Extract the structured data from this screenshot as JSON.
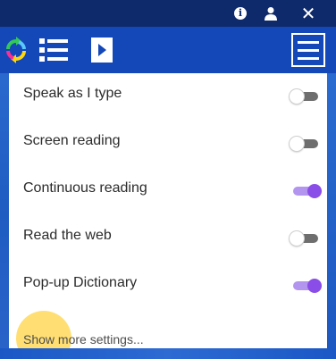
{
  "titlebar": {
    "info_icon": "info-icon",
    "user_icon": "user-icon",
    "close_glyph": "✕"
  },
  "toolbar": {
    "icons": [
      "sync-icon",
      "list-icon",
      "play-icon",
      "hamburger-menu-icon"
    ]
  },
  "settings": {
    "items": [
      {
        "label": "Speak as I type",
        "enabled": false
      },
      {
        "label": "Screen reading",
        "enabled": false
      },
      {
        "label": "Continuous reading",
        "enabled": true
      },
      {
        "label": "Read the web",
        "enabled": false
      },
      {
        "label": "Pop-up Dictionary",
        "enabled": true
      }
    ],
    "more_label": "Show more settings..."
  },
  "colors": {
    "titlebar": "#0e2a6b",
    "toolbar": "#1447b8",
    "toggle_on": "#8a4de8",
    "toggle_on_track": "#b394ef",
    "toggle_off_track": "#6e6e6e",
    "highlight": "#ffc400"
  }
}
